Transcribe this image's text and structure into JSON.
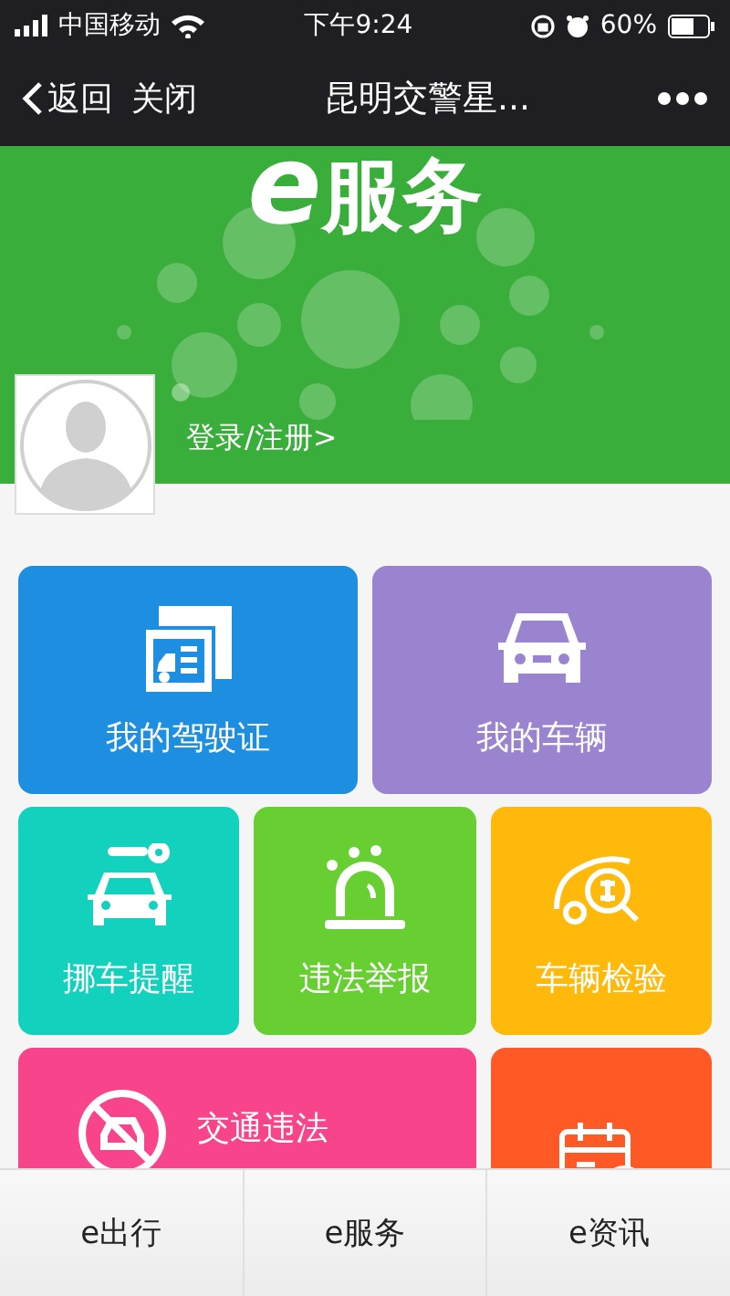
{
  "status_bar": {
    "carrier": "中国移动",
    "time": "下午9:24",
    "battery": "60%"
  },
  "nav": {
    "back": "返回",
    "close": "关闭",
    "title": "昆明交警星..."
  },
  "banner": {
    "logo_letter": "e",
    "logo_text": "服务",
    "login": "登录/注册>"
  },
  "tiles": [
    {
      "kind": "license",
      "label": "我的驾驶证",
      "color": "#1e8fe0"
    },
    {
      "kind": "vehicle",
      "label": "我的车辆",
      "color": "#9a84d0"
    },
    {
      "kind": "move_car",
      "label": "挪车提醒",
      "color": "#12d1bd"
    },
    {
      "kind": "report",
      "label": "违法举报",
      "color": "#68cf32"
    },
    {
      "kind": "inspect",
      "label": "车辆检验",
      "color": "#ffb90a"
    },
    {
      "kind": "violation",
      "label": "交通违法",
      "color": "#f7448b"
    },
    {
      "kind": "calendar",
      "color": "#ff5a26"
    }
  ],
  "tab_bar": [
    {
      "label": "e出行"
    },
    {
      "label": "e服务"
    },
    {
      "label": "e资讯"
    }
  ]
}
